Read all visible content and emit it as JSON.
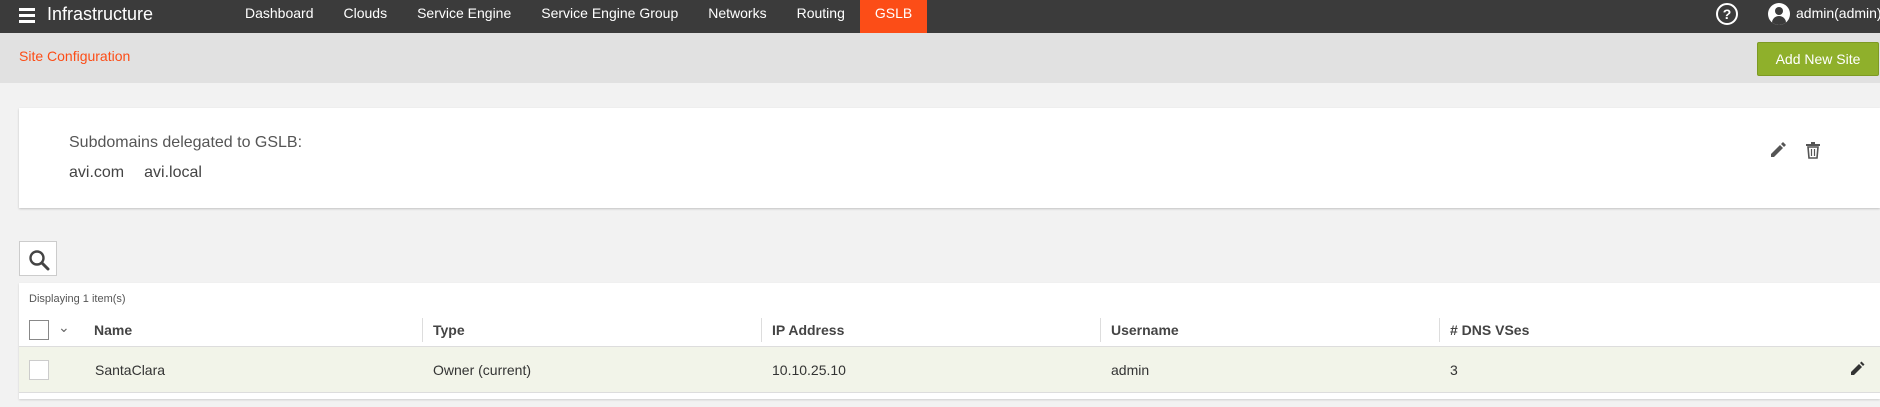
{
  "topbar": {
    "title": "Infrastructure",
    "nav": [
      "Dashboard",
      "Clouds",
      "Service Engine",
      "Service Engine Group",
      "Networks",
      "Routing",
      "GSLB"
    ],
    "active_tab": "GSLB",
    "help": "?",
    "user": "admin(admin)"
  },
  "subheader": {
    "title": "Site Configuration",
    "add_button": "Add New Site"
  },
  "dns_card": {
    "label": "Subdomains delegated to GSLB:",
    "domains": [
      "avi.com",
      "avi.local"
    ]
  },
  "table": {
    "displaying": "Displaying 1 item(s)",
    "columns": [
      "Name",
      "Type",
      "IP Address",
      "Username",
      "# DNS VSes"
    ],
    "rows": [
      {
        "name": "SantaClara",
        "type": "Owner (current)",
        "ip": "10.10.25.10",
        "username": "admin",
        "dns_vses": "3"
      }
    ]
  },
  "colors": {
    "topbar": "#3b3b3b",
    "accent": "#fc4d17",
    "add_button": "#8fb02b",
    "row_highlight": "#f2f4e9"
  },
  "icons": [
    "menu-icon",
    "help-icon",
    "user-icon",
    "edit-icon",
    "trash-icon",
    "search-icon",
    "chevron-down-icon"
  ]
}
